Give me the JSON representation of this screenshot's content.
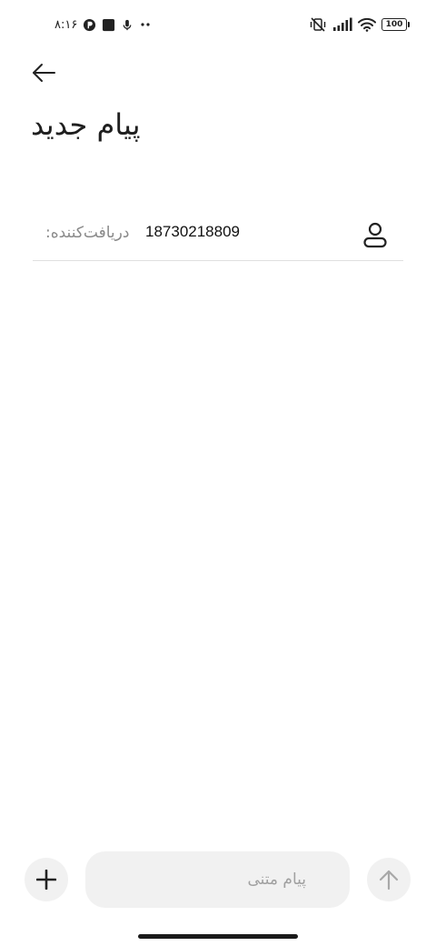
{
  "status_bar": {
    "time": "۸:۱۶",
    "battery_level": "100",
    "icons_left": [
      "app-notification-icon",
      "square-notification-icon",
      "microphone-icon",
      "more-dots-icon"
    ],
    "icons_right": [
      "vibrate-off-icon",
      "signal-icon",
      "wifi-icon",
      "battery-icon"
    ]
  },
  "header": {
    "title": "پیام جدید",
    "back_icon": "arrow-left-icon"
  },
  "recipient": {
    "label": "دریافت‌کننده:",
    "value": "18730218809",
    "contact_icon": "person-icon"
  },
  "compose": {
    "placeholder": "پیام متنی",
    "add_icon": "plus-icon",
    "send_icon": "arrow-up-icon"
  },
  "colors": {
    "background": "#ffffff",
    "text_primary": "#1f1f1f",
    "text_hint": "#8a8a8a",
    "input_background": "#f1f1f1",
    "divider": "#e0e0e0"
  }
}
